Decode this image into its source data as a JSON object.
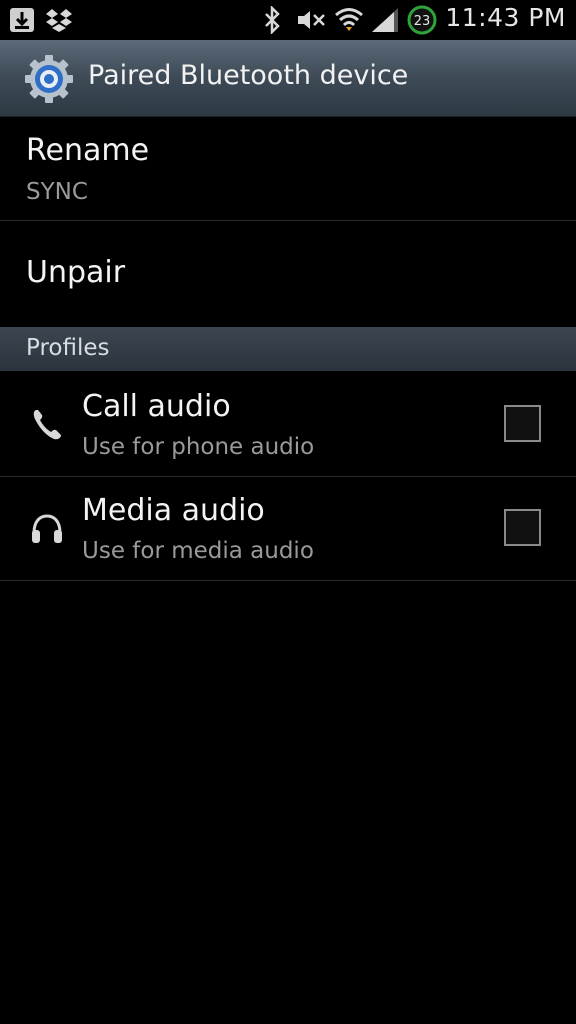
{
  "status_bar": {
    "time": "11:43 PM",
    "battery_text": "23",
    "icons": [
      "download-icon",
      "dropbox-icon",
      "bluetooth-icon",
      "mute-icon",
      "wifi-icon",
      "signal-icon",
      "battery-icon"
    ]
  },
  "header": {
    "title": "Paired Bluetooth device",
    "icon": "settings-gear-icon"
  },
  "items": {
    "rename": {
      "title": "Rename",
      "subtitle": "SYNC"
    },
    "unpair": {
      "title": "Unpair"
    }
  },
  "profiles": {
    "header": "Profiles",
    "items": [
      {
        "title": "Call audio",
        "subtitle": "Use for phone audio",
        "icon": "phone-icon",
        "checked": false
      },
      {
        "title": "Media audio",
        "subtitle": "Use for media audio",
        "icon": "headphones-icon",
        "checked": false
      }
    ]
  },
  "colors": {
    "background": "#000000",
    "title_bar": "#3e4b57",
    "secondary_text": "#9a9a9a"
  }
}
